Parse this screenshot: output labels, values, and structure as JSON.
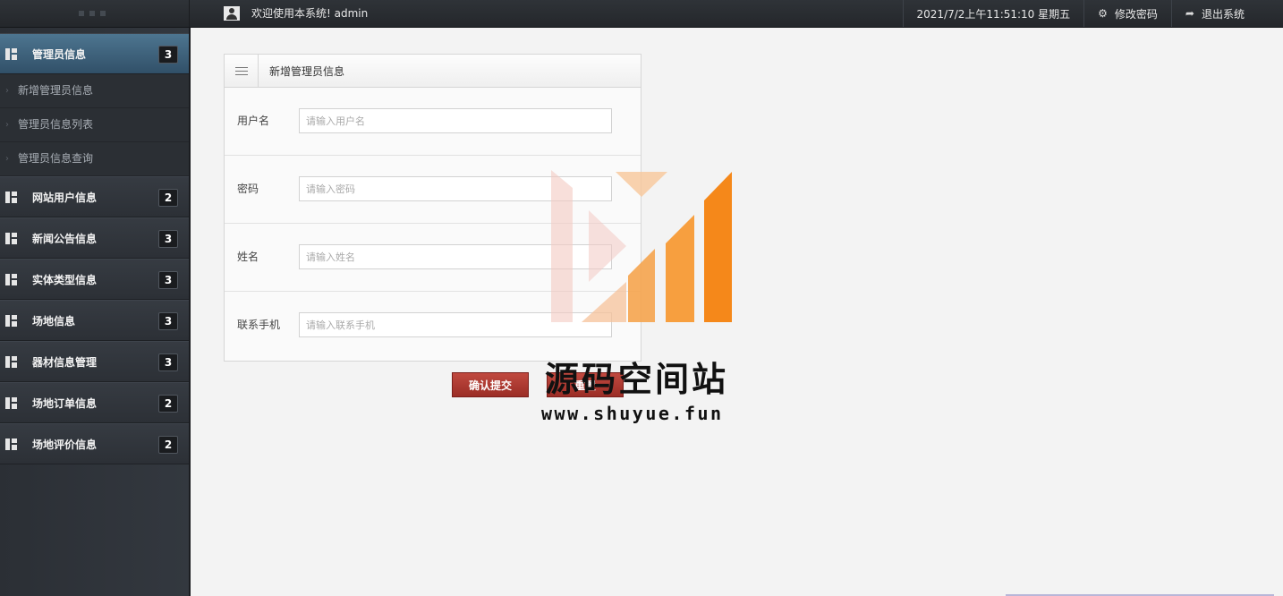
{
  "header": {
    "welcome": "欢迎使用本系统! admin",
    "datetime": "2021/7/2上午11:51:10 星期五",
    "change_password": "修改密码",
    "logout": "退出系统"
  },
  "sidebar": {
    "groups": [
      {
        "label": "管理员信息",
        "count": "3",
        "active": true,
        "items": [
          "新增管理员信息",
          "管理员信息列表",
          "管理员信息查询"
        ]
      },
      {
        "label": "网站用户信息",
        "count": "2"
      },
      {
        "label": "新闻公告信息",
        "count": "3"
      },
      {
        "label": "实体类型信息",
        "count": "3"
      },
      {
        "label": "场地信息",
        "count": "3"
      },
      {
        "label": "器材信息管理",
        "count": "3"
      },
      {
        "label": "场地订单信息",
        "count": "2"
      },
      {
        "label": "场地评价信息",
        "count": "2"
      }
    ]
  },
  "form": {
    "title": "新增管理员信息",
    "fields": [
      {
        "label": "用户名",
        "placeholder": "请输入用户名",
        "value": ""
      },
      {
        "label": "密码",
        "placeholder": "请输入密码",
        "value": ""
      },
      {
        "label": "姓名",
        "placeholder": "请输入姓名",
        "value": ""
      },
      {
        "label": "联系手机",
        "placeholder": "请输入联系手机",
        "value": ""
      }
    ],
    "submit": "确认提交",
    "reset": "重置"
  },
  "watermark": {
    "name": "源码空间站",
    "url": "www.shuyue.fun"
  },
  "colors": {
    "topbar": "#2a2e33",
    "sidebar": "#2f3339",
    "active_menu": "#3f6580",
    "button": "#a8352d",
    "wm_orange": "#f5901e",
    "wm_pink": "#f3c9c2"
  },
  "icons": {
    "user": "user-icon",
    "settings": "gear-icon",
    "logout": "share-arrow-icon",
    "menu_group": "grid-icon",
    "panel": "hamburger-icon"
  }
}
